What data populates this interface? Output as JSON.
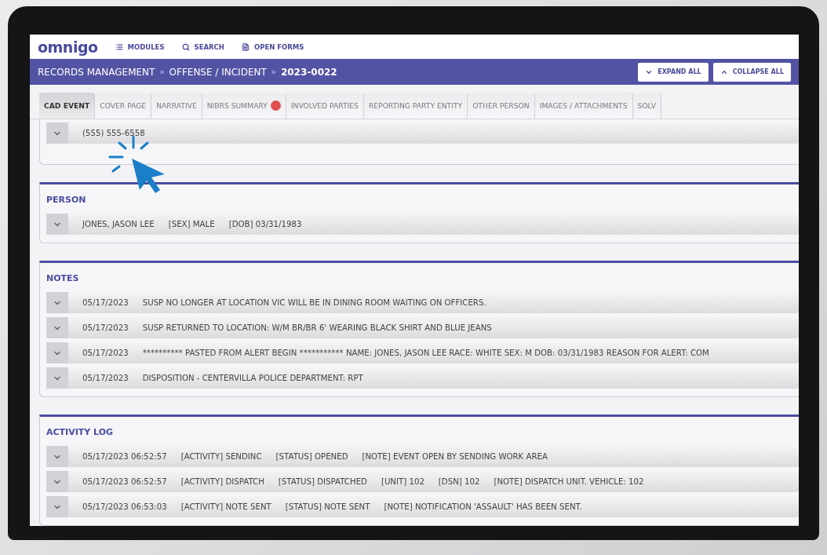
{
  "brand": "omnigo",
  "nav": [
    {
      "label": "MODULES"
    },
    {
      "label": "SEARCH"
    },
    {
      "label": "OPEN FORMS"
    }
  ],
  "breadcrumb": {
    "separator": "»",
    "items": [
      {
        "label": "RECORDS MANAGEMENT",
        "current": false
      },
      {
        "label": "OFFENSE / INCIDENT",
        "current": false
      },
      {
        "label": "2023-0022",
        "current": true
      }
    ]
  },
  "actions": [
    {
      "label": "EXPAND ALL",
      "kind": "expand"
    },
    {
      "label": "COLLAPSE ALL",
      "kind": "collapse"
    }
  ],
  "tabs": [
    {
      "label": "CAD EVENT",
      "selected": true,
      "alert": false
    },
    {
      "label": "COVER PAGE",
      "selected": false,
      "alert": false
    },
    {
      "label": "NARRATIVE",
      "selected": false,
      "alert": false
    },
    {
      "label": "NIBRS SUMMARY",
      "selected": false,
      "alert": true
    },
    {
      "label": "INVOLVED PARTIES",
      "selected": false,
      "alert": false
    },
    {
      "label": "REPORTING PARTY ENTITY",
      "selected": false,
      "alert": false
    },
    {
      "label": "OTHER PERSON",
      "selected": false,
      "alert": false
    },
    {
      "label": "IMAGES / ATTACHMENTS",
      "selected": false,
      "alert": false
    },
    {
      "label": "SOLV",
      "selected": false,
      "alert": false
    }
  ],
  "sections": [
    {
      "rows": [
        {
          "fields": [
            "(555) 555-6558"
          ]
        }
      ]
    },
    {
      "title": "PERSON",
      "rows": [
        {
          "fields": [
            "JONES, JASON LEE",
            "[SEX] MALE",
            "[DOB] 03/31/1983"
          ]
        }
      ]
    },
    {
      "title": "NOTES",
      "rows": [
        {
          "fields": [
            "05/17/2023",
            "SUSP NO LONGER AT LOCATION VIC WILL BE IN DINING ROOM WAITING ON OFFICERS."
          ]
        },
        {
          "fields": [
            "05/17/2023",
            "SUSP RETURNED TO LOCATION: W/M BR/BR 6' WEARING BLACK SHIRT AND BLUE JEANS"
          ]
        },
        {
          "fields": [
            "05/17/2023",
            "********** PASTED FROM ALERT BEGIN *********** NAME: JONES, JASON LEE RACE: WHITE SEX: M DOB: 03/31/1983 REASON FOR ALERT: COM"
          ]
        },
        {
          "fields": [
            "05/17/2023",
            "DISPOSITION - CENTERVILLA POLICE DEPARTMENT: RPT"
          ]
        }
      ]
    },
    {
      "title": "ACTIVITY LOG",
      "rows": [
        {
          "fields": [
            "05/17/2023 06:52:57",
            "[ACTIVITY] SENDINC",
            "[STATUS] OPENED",
            "[NOTE] EVENT OPEN BY SENDING WORK AREA"
          ]
        },
        {
          "fields": [
            "05/17/2023 06:52:57",
            "[ACTIVITY] DISPATCH",
            "[STATUS] DISPATCHED",
            "[UNIT] 102",
            "[DSN] 102",
            "[NOTE] DISPATCH UNIT. VEHICLE: 102"
          ]
        },
        {
          "fields": [
            "05/17/2023 06:53:03",
            "[ACTIVITY] NOTE SENT",
            "[STATUS] NOTE SENT",
            "[NOTE] NOTIFICATION 'ASSAULT' HAS BEEN SENT."
          ]
        }
      ]
    }
  ]
}
